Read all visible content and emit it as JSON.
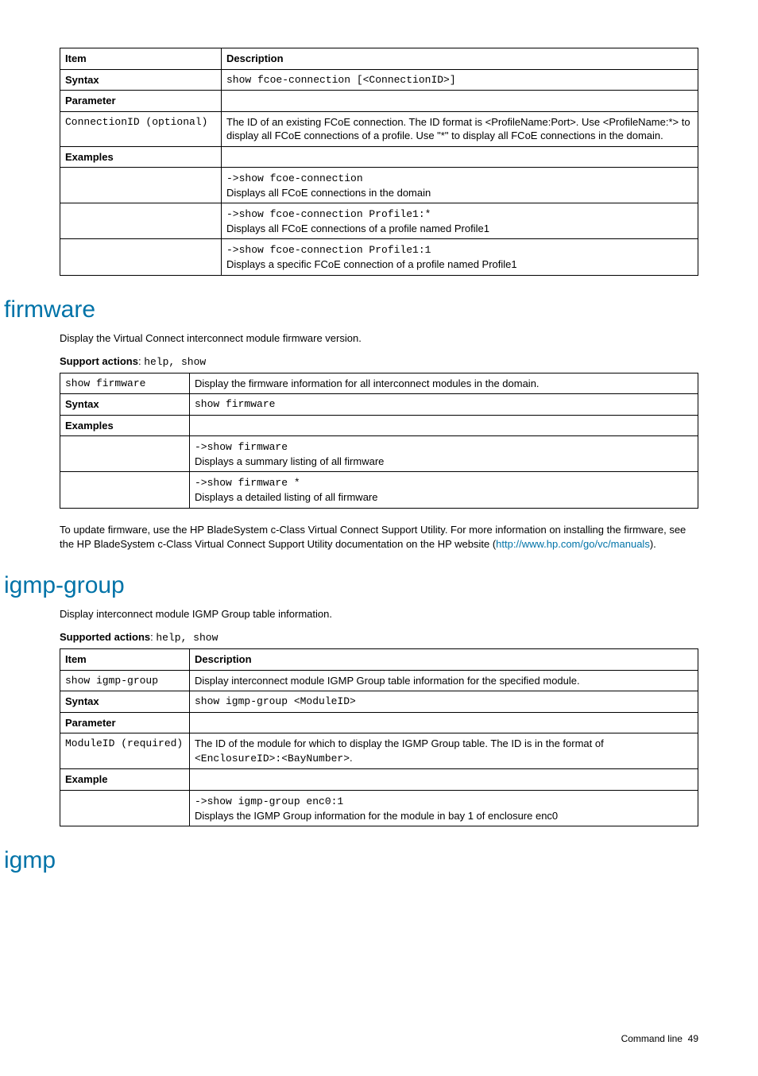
{
  "table1": {
    "headers": {
      "item": "Item",
      "desc": "Description"
    },
    "rows": {
      "syntax_label": "Syntax",
      "syntax_value": "show fcoe-connection [<ConnectionID>]",
      "parameter_label": "Parameter",
      "param_name": "ConnectionID (optional)",
      "param_desc": "The ID of an existing FCoE connection. The ID format is <ProfileName:Port>. Use <ProfileName:*> to display all FCoE connections of a profile. Use \"*\" to display all FCoE connections in the domain.",
      "examples_label": "Examples",
      "ex1_cmd": "->show fcoe-connection",
      "ex1_desc": "Displays all FCoE connections in the domain",
      "ex2_cmd": "->show fcoe-connection Profile1:*",
      "ex2_desc": "Displays all FCoE connections of a profile named Profile1",
      "ex3_cmd": "->show fcoe-connection Profile1:1",
      "ex3_desc": "Displays a specific FCoE connection of a profile named Profile1"
    }
  },
  "firmware": {
    "heading": "firmware",
    "intro": "Display the Virtual Connect interconnect module firmware version.",
    "support_label": "Support actions",
    "support_value": "help, show",
    "table": {
      "cmd": "show firmware",
      "cmd_desc": "Display the firmware information for all interconnect modules in the domain.",
      "syntax_label": "Syntax",
      "syntax_value": "show firmware",
      "examples_label": "Examples",
      "ex1_cmd": "->show firmware",
      "ex1_desc": "Displays a summary listing of all firmware",
      "ex2_cmd": "->show firmware *",
      "ex2_desc": "Displays a detailed listing of all firmware"
    },
    "after1": "To update firmware, use the HP BladeSystem c-Class Virtual Connect Support Utility. For more information on installing the firmware, see the HP BladeSystem c-Class Virtual Connect Support Utility documentation on the HP website (",
    "link": "http://www.hp.com/go/vc/manuals",
    "after2": ")."
  },
  "igmp_group": {
    "heading": "igmp-group",
    "intro": "Display interconnect module IGMP Group table information.",
    "support_label": "Supported actions",
    "support_value": "help, show",
    "table": {
      "headers": {
        "item": "Item",
        "desc": "Description"
      },
      "cmd": "show igmp-group",
      "cmd_desc": "Display interconnect module IGMP Group table information for the specified module.",
      "syntax_label": "Syntax",
      "syntax_value": "show igmp-group <ModuleID>",
      "parameter_label": "Parameter",
      "param_name": "ModuleID (required)",
      "param_desc_pre": "The ID of the module for which to display the IGMP Group table. The ID is in the format of ",
      "param_desc_code": "<EnclosureID>:<BayNumber>",
      "param_desc_post": ".",
      "example_label": "Example",
      "ex1_cmd": "->show igmp-group enc0:1",
      "ex1_desc": "Displays the IGMP Group information for the module in bay 1 of enclosure enc0"
    }
  },
  "igmp": {
    "heading": "igmp"
  },
  "footer": {
    "label": "Command line",
    "page": "49"
  }
}
